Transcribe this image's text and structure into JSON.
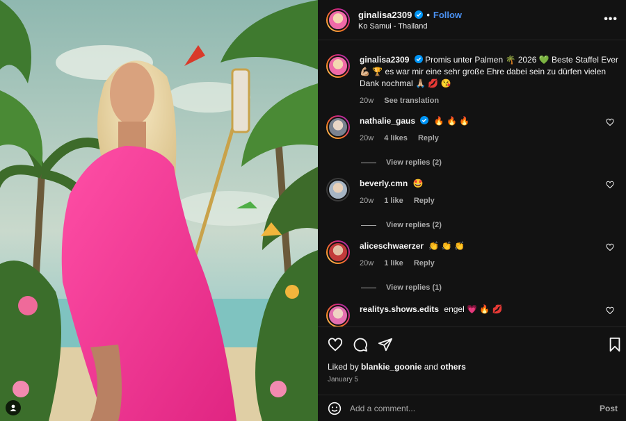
{
  "post": {
    "username": "ginalisa2309",
    "follow_label": "Follow",
    "separator": "•",
    "location": "Ko Samui - Thailand",
    "more_label": "•••",
    "caption_line1": "Promis unter Palmen 🌴 2026 💚 Beste Staffel Ever 💪🏼 🏆 es war mir eine sehr große Ehre dabei sein zu dürfen vielen Dank nochmal 🙏🏼 💋 😘",
    "caption_time": "20w",
    "see_translation": "See translation",
    "liked_prefix": "Liked by",
    "liked_user": "blankie_goonie",
    "liked_and": "and",
    "liked_others": "others",
    "date": "January 5",
    "comment_placeholder": "Add a comment...",
    "post_label": "Post"
  },
  "comments": [
    {
      "username": "nathalie_gaus",
      "verified": true,
      "text": "🔥 🔥 🔥",
      "time": "20w",
      "likes": "4 likes",
      "reply": "Reply",
      "view_replies": "View replies (2)"
    },
    {
      "username": "beverly.cmn",
      "verified": false,
      "text": "🤩",
      "time": "20w",
      "likes": "1 like",
      "reply": "Reply",
      "view_replies": "View replies (2)"
    },
    {
      "username": "aliceschwaerzer",
      "verified": false,
      "text": "👏 👏 👏",
      "time": "20w",
      "likes": "1 like",
      "reply": "Reply",
      "view_replies": "View replies (1)"
    },
    {
      "username": "realitys.shows.edits",
      "verified": false,
      "text": "engel 💗 🔥 💋",
      "time": "",
      "likes": "",
      "reply": "",
      "view_replies": ""
    }
  ],
  "icons": {
    "like": "heart-icon",
    "comment": "comment-icon",
    "share": "share-icon",
    "save": "bookmark-icon",
    "emoji": "emoji-icon",
    "tag": "person-tag-icon",
    "verified": "verified-badge-icon"
  },
  "colors": {
    "background": "#121212",
    "accent": "#4a90f0",
    "secondary_text": "#a8a8a8",
    "verified": "#0095f6"
  }
}
